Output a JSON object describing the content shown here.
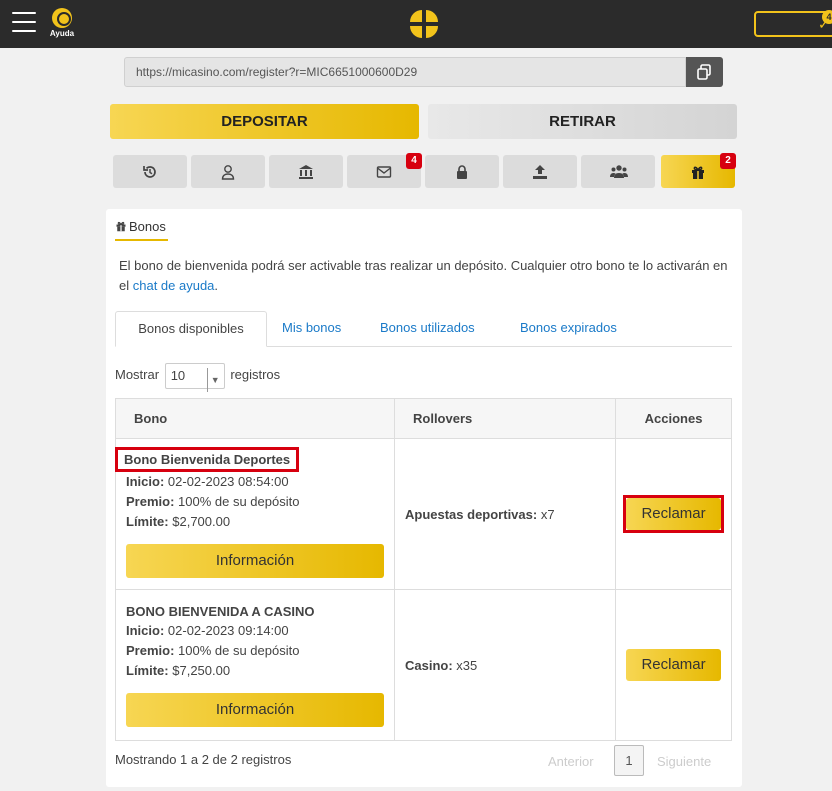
{
  "header": {
    "help_label": "Ayuda",
    "notif_count": "4"
  },
  "referral": {
    "url": "https://micasino.com/register?r=MIC6651000600D29"
  },
  "actions": {
    "deposit": "DEPOSITAR",
    "withdraw": "RETIRAR"
  },
  "icon_tabs": [
    {
      "icon": "history-icon"
    },
    {
      "icon": "user-icon"
    },
    {
      "icon": "bank-icon"
    },
    {
      "icon": "mail-icon",
      "badge": "4"
    },
    {
      "icon": "lock-icon"
    },
    {
      "icon": "upload-icon"
    },
    {
      "icon": "users-icon"
    },
    {
      "icon": "gift-icon",
      "badge": "2"
    }
  ],
  "bonos": {
    "section_title": "Bonos",
    "intro_text": "El bono de bienvenida podrá ser activable tras realizar un depósito. Cualquier otro bono te lo activarán en el ",
    "intro_link": "chat de ayuda",
    "intro_end": ".",
    "tabs": [
      "Bonos disponibles",
      "Mis bonos",
      "Bonos utilizados",
      "Bonos expirados"
    ],
    "show_label": "Mostrar",
    "show_value": "10",
    "records_label": "registros",
    "columns": [
      "Bono",
      "Rollovers",
      "Acciones"
    ],
    "rows": [
      {
        "name": "Bono Bienvenida Deportes",
        "start_label": "Inicio:",
        "start": "02-02-2023 08:54:00",
        "prize_label": "Premio:",
        "prize": "100% de su depósito",
        "limit_label": "Límite:",
        "limit": "$2,700.00",
        "info": "Información",
        "rollover_label": "Apuestas deportivas:",
        "rollover": "x7",
        "claim": "Reclamar"
      },
      {
        "name": "BONO BIENVENIDA A CASINO",
        "start_label": "Inicio:",
        "start": "02-02-2023 09:14:00",
        "prize_label": "Premio:",
        "prize": "100% de su depósito",
        "limit_label": "Límite:",
        "limit": "$7,250.00",
        "info": "Información",
        "rollover_label": "Casino:",
        "rollover": "x35",
        "claim": "Reclamar"
      }
    ],
    "info_text": "Mostrando 1 a 2 de 2 registros",
    "pager": {
      "prev": "Anterior",
      "page": "1",
      "next": "Siguiente"
    }
  },
  "colors": {
    "accent": "#e6b800",
    "topbar": "#2b2b2b",
    "highlight": "#d7000f",
    "link": "#1a7ac8"
  }
}
